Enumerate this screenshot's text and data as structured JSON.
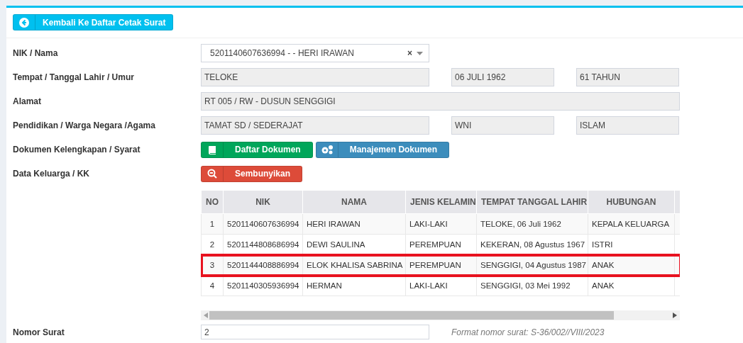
{
  "back_button": {
    "label": "Kembali Ke Daftar Cetak Surat"
  },
  "form": [
    {
      "kind": "select",
      "label": "NIK / Nama",
      "value": "5201140607636994 - - HERI IRAWAN",
      "clear": "×"
    },
    {
      "kind": "fields",
      "label": "Tempat / Tanggal Lahir / Umur",
      "values": [
        "TELOKE",
        "06 JULI 1962",
        "61 TAHUN"
      ]
    },
    {
      "kind": "wide",
      "label": "Alamat",
      "values": [
        "RT 005 / RW - DUSUN SENGGIGI"
      ]
    },
    {
      "kind": "fields",
      "label": "Pendidikan / Warga Negara /Agama",
      "values": [
        "TAMAT SD / SEDERAJAT",
        "WNI",
        "ISLAM"
      ]
    },
    {
      "kind": "buttons",
      "label": "Dokumen Kelengkapan / Syarat",
      "buttons": [
        {
          "label": "Daftar Dokumen",
          "color": "#00a65a"
        },
        {
          "label": "Manajemen Dokumen",
          "color": "#3c8dbc"
        }
      ]
    },
    {
      "kind": "buttons",
      "label": "Data Keluarga / KK",
      "buttons": [
        {
          "label": "Sembunyikan",
          "color": "#dd4b39"
        }
      ]
    }
  ],
  "table": {
    "columns": [
      "NO",
      "NIK",
      "NAMA",
      "JENIS KELAMIN",
      "TEMPAT TANGGAL LAHIR",
      "HUBUNGAN"
    ],
    "rows": [
      {
        "cells": [
          "1",
          "5201140607636994",
          "HERI IRAWAN",
          "LAKI-LAKI",
          "TELOKE, 06 Juli 1962",
          "KEPALA KELUARGA"
        ],
        "highlighted": false
      },
      {
        "cells": [
          "2",
          "5201144808686994",
          "DEWI SAULINA",
          "PEREMPUAN",
          "KEKERAN, 08 Agustus 1967",
          "ISTRI"
        ],
        "highlighted": false
      },
      {
        "cells": [
          "3",
          "5201144408886994",
          "ELOK KHALISA SABRINA",
          "PEREMPUAN",
          "SENGGIGI, 04 Agustus 1987",
          "ANAK"
        ],
        "highlighted": true
      },
      {
        "cells": [
          "4",
          "5201140305936994",
          "HERMAN",
          "LAKI-LAKI",
          "SENGGIGI, 03 Mei 1992",
          "ANAK"
        ],
        "highlighted": false
      }
    ]
  },
  "nomor_surat": {
    "label": "Nomor Surat",
    "value": "2",
    "hint": "Format nomor surat: S-36/002//VIII/2023"
  }
}
